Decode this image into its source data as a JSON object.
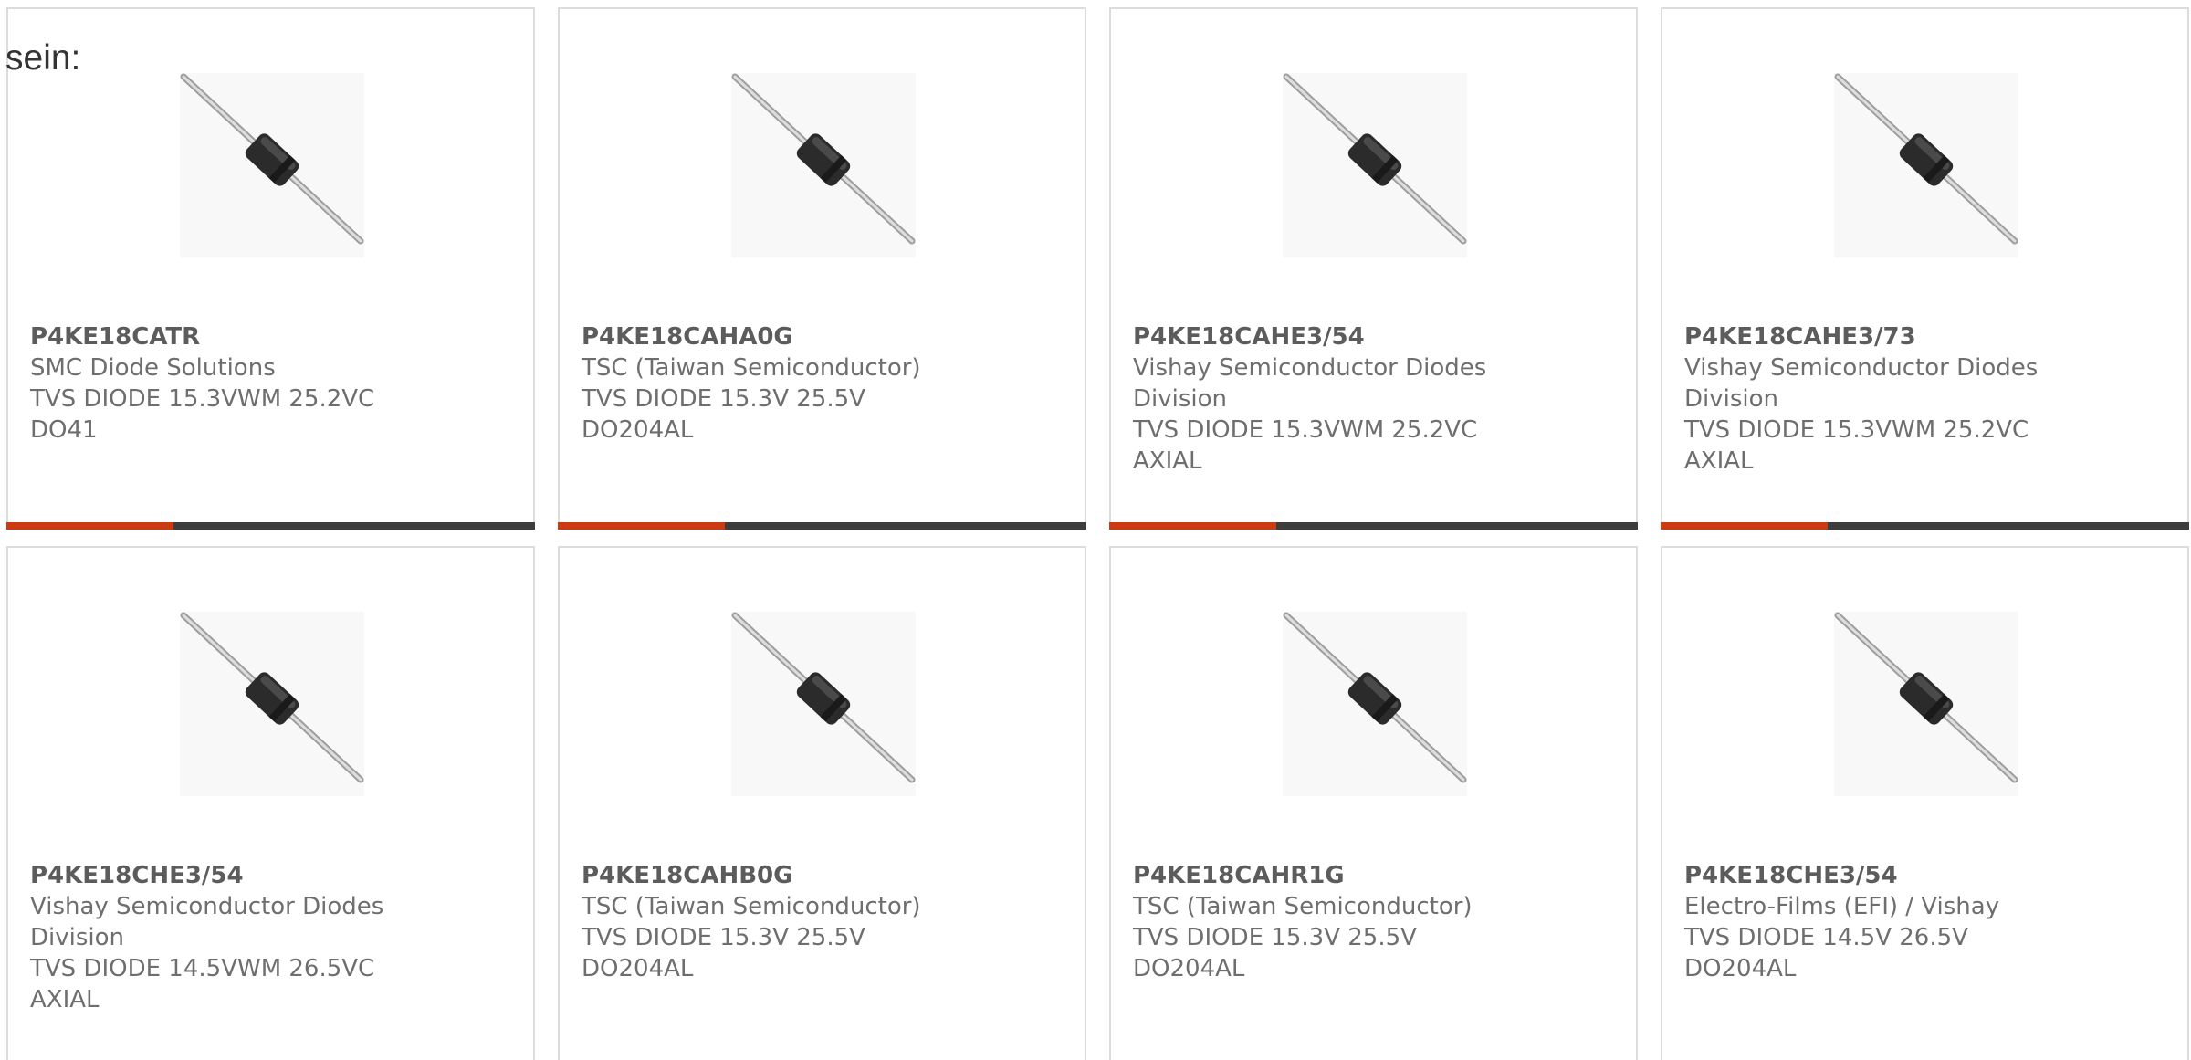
{
  "intro_text": "sein:",
  "colors": {
    "accent_bar": "#cc3a12",
    "dark_bar": "#3d3d3d"
  },
  "product_image_icon": "axial-diode-icon",
  "products": [
    {
      "part_number": "P4KE18CATR",
      "manufacturer": "SMC Diode Solutions",
      "description": "TVS DIODE 15.3VWM 25.2VC",
      "package": "DO41"
    },
    {
      "part_number": "P4KE18CAHA0G",
      "manufacturer": "TSC (Taiwan Semiconductor)",
      "description": "TVS DIODE 15.3V 25.5V",
      "package": "DO204AL"
    },
    {
      "part_number": "P4KE18CAHE3/54",
      "manufacturer": "Vishay Semiconductor Diodes Division",
      "description": "TVS DIODE 15.3VWM 25.2VC",
      "package": "AXIAL"
    },
    {
      "part_number": "P4KE18CAHE3/73",
      "manufacturer": "Vishay Semiconductor Diodes Division",
      "description": "TVS DIODE 15.3VWM 25.2VC",
      "package": "AXIAL"
    },
    {
      "part_number": "P4KE18CHE3/54",
      "manufacturer": "Vishay Semiconductor Diodes Division",
      "description": "TVS DIODE 14.5VWM 26.5VC",
      "package": "AXIAL"
    },
    {
      "part_number": "P4KE18CAHB0G",
      "manufacturer": "TSC (Taiwan Semiconductor)",
      "description": "TVS DIODE 15.3V 25.5V",
      "package": "DO204AL"
    },
    {
      "part_number": "P4KE18CAHR1G",
      "manufacturer": "TSC (Taiwan Semiconductor)",
      "description": "TVS DIODE 15.3V 25.5V",
      "package": "DO204AL"
    },
    {
      "part_number": "P4KE18CHE3/54",
      "manufacturer": "Electro-Films (EFI) / Vishay",
      "description": "TVS DIODE 14.5V 26.5V",
      "package": "DO204AL"
    }
  ]
}
